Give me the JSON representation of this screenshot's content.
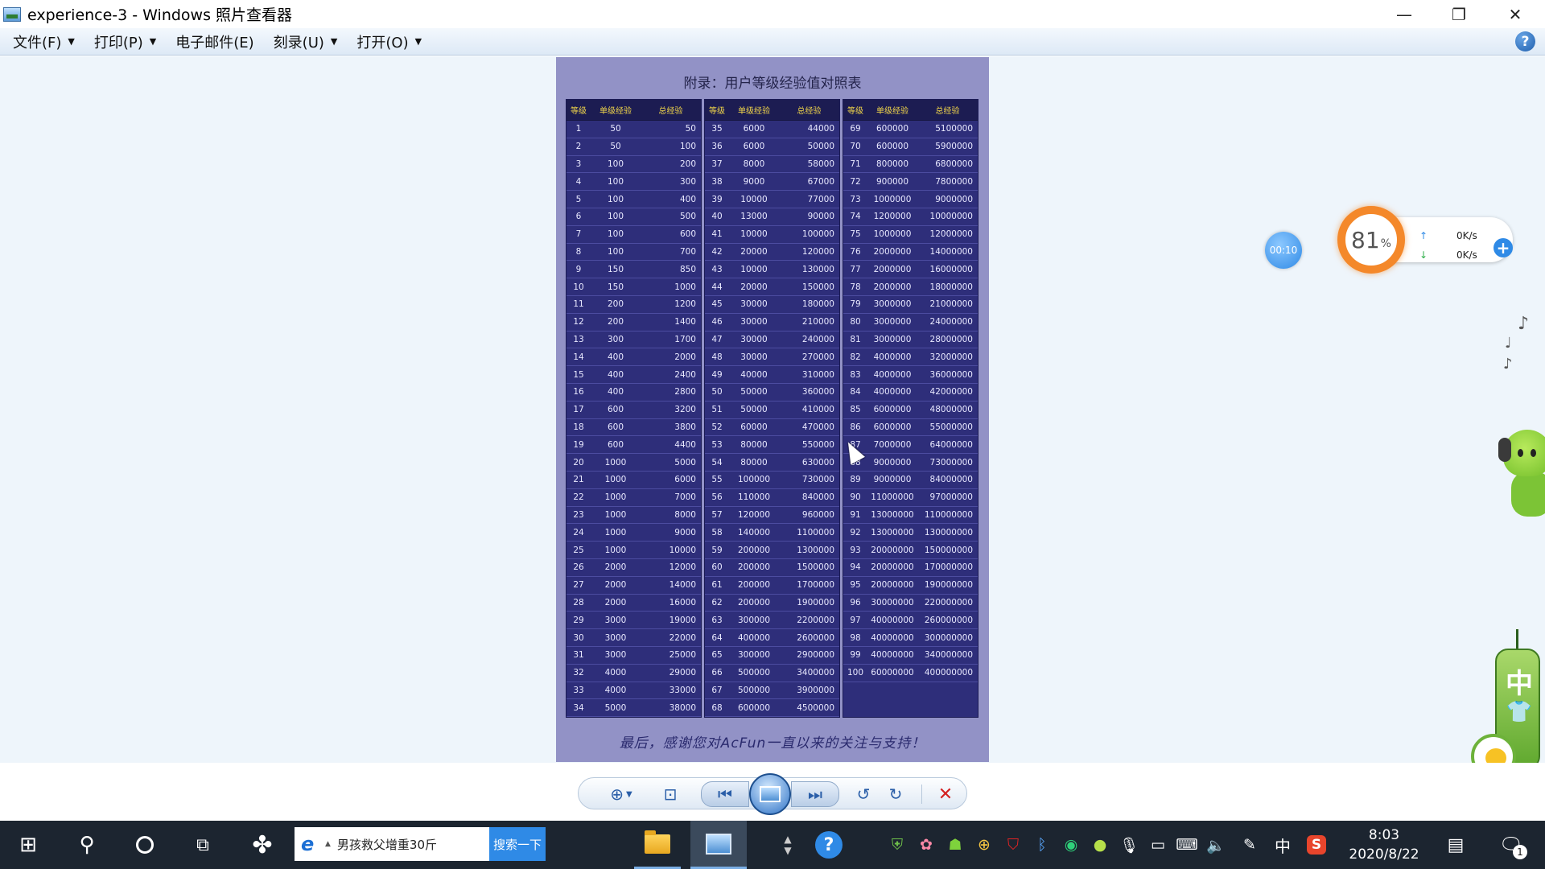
{
  "window": {
    "title": "experience-3 - Windows 照片查看器",
    "minimize_glyph": "—",
    "maximize_glyph": "❐",
    "close_glyph": "✕"
  },
  "menu": {
    "items": [
      {
        "label": "文件(F)",
        "has_dropdown": true
      },
      {
        "label": "打印(P)",
        "has_dropdown": true
      },
      {
        "label": "电子邮件(E)",
        "has_dropdown": false
      },
      {
        "label": "刻录(U)",
        "has_dropdown": true
      },
      {
        "label": "打开(O)",
        "has_dropdown": true
      }
    ],
    "help_glyph": "?"
  },
  "photo": {
    "title": "附录：用户等级经验值对照表",
    "headers": {
      "level": "等级",
      "single": "单级经验",
      "total": "总经验"
    },
    "footer": "最后，感谢您对AcFun一直以来的关注与支持！",
    "columns": [
      [
        [
          "1",
          "50",
          "50"
        ],
        [
          "2",
          "50",
          "100"
        ],
        [
          "3",
          "100",
          "200"
        ],
        [
          "4",
          "100",
          "300"
        ],
        [
          "5",
          "100",
          "400"
        ],
        [
          "6",
          "100",
          "500"
        ],
        [
          "7",
          "100",
          "600"
        ],
        [
          "8",
          "100",
          "700"
        ],
        [
          "9",
          "150",
          "850"
        ],
        [
          "10",
          "150",
          "1000"
        ],
        [
          "11",
          "200",
          "1200"
        ],
        [
          "12",
          "200",
          "1400"
        ],
        [
          "13",
          "300",
          "1700"
        ],
        [
          "14",
          "400",
          "2000"
        ],
        [
          "15",
          "400",
          "2400"
        ],
        [
          "16",
          "400",
          "2800"
        ],
        [
          "17",
          "600",
          "3200"
        ],
        [
          "18",
          "600",
          "3800"
        ],
        [
          "19",
          "600",
          "4400"
        ],
        [
          "20",
          "1000",
          "5000"
        ],
        [
          "21",
          "1000",
          "6000"
        ],
        [
          "22",
          "1000",
          "7000"
        ],
        [
          "23",
          "1000",
          "8000"
        ],
        [
          "24",
          "1000",
          "9000"
        ],
        [
          "25",
          "1000",
          "10000"
        ],
        [
          "26",
          "2000",
          "12000"
        ],
        [
          "27",
          "2000",
          "14000"
        ],
        [
          "28",
          "2000",
          "16000"
        ],
        [
          "29",
          "3000",
          "19000"
        ],
        [
          "30",
          "3000",
          "22000"
        ],
        [
          "31",
          "3000",
          "25000"
        ],
        [
          "32",
          "4000",
          "29000"
        ],
        [
          "33",
          "4000",
          "33000"
        ],
        [
          "34",
          "5000",
          "38000"
        ]
      ],
      [
        [
          "35",
          "6000",
          "44000"
        ],
        [
          "36",
          "6000",
          "50000"
        ],
        [
          "37",
          "8000",
          "58000"
        ],
        [
          "38",
          "9000",
          "67000"
        ],
        [
          "39",
          "10000",
          "77000"
        ],
        [
          "40",
          "13000",
          "90000"
        ],
        [
          "41",
          "10000",
          "100000"
        ],
        [
          "42",
          "20000",
          "120000"
        ],
        [
          "43",
          "10000",
          "130000"
        ],
        [
          "44",
          "20000",
          "150000"
        ],
        [
          "45",
          "30000",
          "180000"
        ],
        [
          "46",
          "30000",
          "210000"
        ],
        [
          "47",
          "30000",
          "240000"
        ],
        [
          "48",
          "30000",
          "270000"
        ],
        [
          "49",
          "40000",
          "310000"
        ],
        [
          "50",
          "50000",
          "360000"
        ],
        [
          "51",
          "50000",
          "410000"
        ],
        [
          "52",
          "60000",
          "470000"
        ],
        [
          "53",
          "80000",
          "550000"
        ],
        [
          "54",
          "80000",
          "630000"
        ],
        [
          "55",
          "100000",
          "730000"
        ],
        [
          "56",
          "110000",
          "840000"
        ],
        [
          "57",
          "120000",
          "960000"
        ],
        [
          "58",
          "140000",
          "1100000"
        ],
        [
          "59",
          "200000",
          "1300000"
        ],
        [
          "60",
          "200000",
          "1500000"
        ],
        [
          "61",
          "200000",
          "1700000"
        ],
        [
          "62",
          "200000",
          "1900000"
        ],
        [
          "63",
          "300000",
          "2200000"
        ],
        [
          "64",
          "400000",
          "2600000"
        ],
        [
          "65",
          "300000",
          "2900000"
        ],
        [
          "66",
          "500000",
          "3400000"
        ],
        [
          "67",
          "500000",
          "3900000"
        ],
        [
          "68",
          "600000",
          "4500000"
        ]
      ],
      [
        [
          "69",
          "600000",
          "5100000"
        ],
        [
          "70",
          "600000",
          "5900000"
        ],
        [
          "71",
          "800000",
          "6800000"
        ],
        [
          "72",
          "900000",
          "7800000"
        ],
        [
          "73",
          "1000000",
          "9000000"
        ],
        [
          "74",
          "1200000",
          "10000000"
        ],
        [
          "75",
          "1000000",
          "12000000"
        ],
        [
          "76",
          "2000000",
          "14000000"
        ],
        [
          "77",
          "2000000",
          "16000000"
        ],
        [
          "78",
          "2000000",
          "18000000"
        ],
        [
          "79",
          "3000000",
          "21000000"
        ],
        [
          "80",
          "3000000",
          "24000000"
        ],
        [
          "81",
          "3000000",
          "28000000"
        ],
        [
          "82",
          "4000000",
          "32000000"
        ],
        [
          "83",
          "4000000",
          "36000000"
        ],
        [
          "84",
          "4000000",
          "42000000"
        ],
        [
          "85",
          "6000000",
          "48000000"
        ],
        [
          "86",
          "6000000",
          "55000000"
        ],
        [
          "87",
          "7000000",
          "64000000"
        ],
        [
          "88",
          "9000000",
          "73000000"
        ],
        [
          "89",
          "9000000",
          "84000000"
        ],
        [
          "90",
          "11000000",
          "97000000"
        ],
        [
          "91",
          "13000000",
          "110000000"
        ],
        [
          "92",
          "13000000",
          "130000000"
        ],
        [
          "93",
          "20000000",
          "150000000"
        ],
        [
          "94",
          "20000000",
          "170000000"
        ],
        [
          "95",
          "20000000",
          "190000000"
        ],
        [
          "96",
          "30000000",
          "220000000"
        ],
        [
          "97",
          "40000000",
          "260000000"
        ],
        [
          "98",
          "40000000",
          "300000000"
        ],
        [
          "99",
          "40000000",
          "340000000"
        ],
        [
          "100",
          "60000000",
          "400000000"
        ],
        [
          "",
          "",
          " "
        ],
        [
          "",
          "",
          ""
        ]
      ]
    ]
  },
  "widgets": {
    "timer": "00:10",
    "speed_percent": "81",
    "percent_sign": "%",
    "upload": "0K/s",
    "download": "0K/s",
    "plus_glyph": "+",
    "tassel_char": "中"
  },
  "toolbar": {
    "zoom_glyph": "⊕",
    "fit_glyph": "⊡",
    "prev_glyph": "⏮",
    "next_glyph": "⏭",
    "rotate_left_glyph": "↺",
    "rotate_right_glyph": "↻",
    "delete_glyph": "✕"
  },
  "taskbar": {
    "search_text": "男孩救父增重30斤",
    "search_button": "搜索一下",
    "time": "8:03",
    "date": "2020/8/22",
    "ime": "中",
    "notification_count": "1",
    "tray_icons": [
      "shield-icon",
      "flower-icon",
      "alien-icon",
      "plus-circle-icon",
      "mcafee-icon",
      "bluetooth-icon",
      "chat-icon",
      "android-icon",
      "mic-icon",
      "battery-icon",
      "network-icon",
      "volume-icon",
      "pen-icon"
    ]
  },
  "colors": {
    "photo_bg": "#9292c6",
    "table_bg": "#2e2e7a",
    "header_text": "#f0d54a",
    "accent": "#2f8ae6",
    "speed_ring": "#f4882a"
  }
}
